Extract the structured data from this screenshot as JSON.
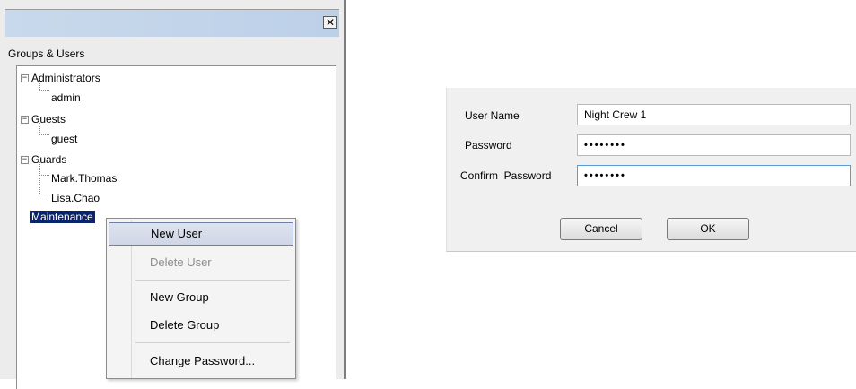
{
  "left_window": {
    "close_glyph": "✕",
    "groups_label": "Groups & Users",
    "tree": {
      "group_administrators": "Administrators",
      "user_admin": "admin",
      "group_guests": "Guests",
      "user_guest": "guest",
      "group_guards": "Guards",
      "user_mark": "Mark.Thomas",
      "user_lisa": "Lisa.Chao",
      "group_maintenance": "Maintenance",
      "expander_glyph": "−"
    }
  },
  "context_menu": {
    "items": [
      {
        "label": "New User",
        "state": "hover"
      },
      {
        "label": "Delete User",
        "state": "disabled"
      },
      {
        "label": "New Group",
        "state": "normal"
      },
      {
        "label": "Delete Group",
        "state": "normal"
      },
      {
        "label": "Change Password...",
        "state": "normal"
      }
    ]
  },
  "dialog": {
    "user_name_label": "User Name",
    "user_name_value": "Night Crew 1",
    "password_label": "Password",
    "password_value": "••••••••",
    "confirm_label": "Confirm  Password",
    "confirm_value": "••••••••",
    "cancel_label": "Cancel",
    "ok_label": "OK"
  },
  "colors": {
    "titlebar": "#c9d9ec",
    "selection": "#0a246a",
    "menu_hover": "#cfd6e6",
    "focus_border": "#5b9bd5"
  }
}
